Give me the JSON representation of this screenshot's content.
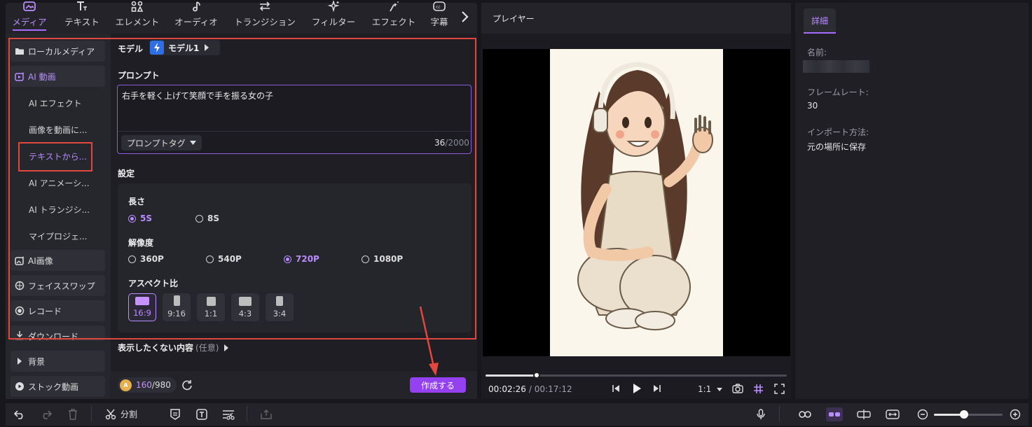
{
  "toolbar": {
    "tabs": [
      {
        "label": "メディア",
        "icon": "media-icon",
        "active": true
      },
      {
        "label": "テキスト",
        "icon": "text-icon"
      },
      {
        "label": "エレメント",
        "icon": "elements-icon"
      },
      {
        "label": "オーディオ",
        "icon": "audio-icon"
      },
      {
        "label": "トランジション",
        "icon": "transition-icon"
      },
      {
        "label": "フィルター",
        "icon": "filter-icon"
      },
      {
        "label": "エフェクト",
        "icon": "effect-icon"
      },
      {
        "label": "字幕",
        "icon": "subtitle-icon"
      }
    ]
  },
  "sidebar": {
    "local_media": "ローカルメディア",
    "ai_video": "AI 動画",
    "sub_items": [
      "AI エフェクト",
      "画像を動画に...",
      "テキストから...",
      "AI アニメーシ...",
      "AI トランジシ...",
      "マイプロジェ..."
    ],
    "ai_image": "AI画像",
    "face_swap": "フェイススワップ",
    "record": "レコード",
    "download": "ダウンロード",
    "background": "背景",
    "stock_video": "ストック動画"
  },
  "main": {
    "model_label": "モデル",
    "model_value": "モデル1",
    "prompt_label": "プロンプト",
    "prompt_text": "右手を軽く上げて笑顔で手を振る女の子",
    "prompt_tag": "プロンプトタグ",
    "char_count": "36",
    "char_max": "/2000",
    "settings_label": "設定",
    "length_label": "長さ",
    "length_options": [
      "5S",
      "8S"
    ],
    "length_selected": "5S",
    "resolution_label": "解像度",
    "resolution_options": [
      "360P",
      "540P",
      "720P",
      "1080P"
    ],
    "resolution_selected": "720P",
    "aspect_label": "アスペクト比",
    "aspect_options": [
      "16:9",
      "9:16",
      "1:1",
      "4:3",
      "3:4"
    ],
    "aspect_selected": "16:9",
    "negative_label": "表示したくない内容",
    "negative_optional": "(任意)",
    "credits_used": "160",
    "credits_total": "/980",
    "create_button": "作成する"
  },
  "player": {
    "title": "プレイヤー",
    "current_time": "00:02:26",
    "total_time": "/ 00:17:12",
    "progress": 0.17,
    "zoom": "1:1"
  },
  "details": {
    "tab": "詳細",
    "name_label": "名前:",
    "framerate_label": "フレームレート:",
    "framerate_value": "30",
    "import_label": "インポート方法:",
    "import_value": "元の場所に保存"
  },
  "bottombar": {
    "split_label": "分割"
  },
  "colors": {
    "accent": "#a76bff",
    "button": "#9441f2",
    "annotation": "#e2473d"
  }
}
